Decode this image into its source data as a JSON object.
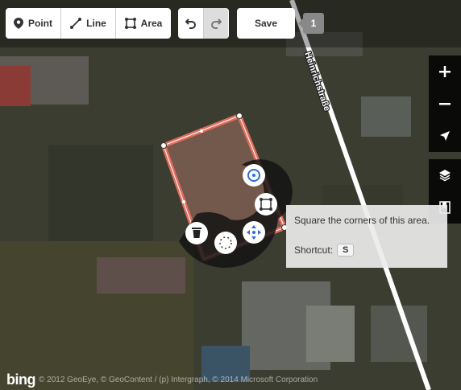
{
  "toolbar": {
    "point_label": "Point",
    "line_label": "Line",
    "area_label": "Area",
    "save_label": "Save",
    "edit_count": "1"
  },
  "map": {
    "street_name": "Heinrichstraße"
  },
  "tooltip": {
    "text": "Square the corners of this area.",
    "shortcut_label": "Shortcut:",
    "shortcut_key": "S"
  },
  "attribution": {
    "logo": "bing",
    "text": "© 2012 GeoEye, © GeoContent / (p) Intergraph, © 2014 Microsoft Corporation"
  },
  "icons": [
    "point-icon",
    "line-icon",
    "area-icon",
    "undo-icon",
    "redo-icon",
    "zoom-in-icon",
    "zoom-out-icon",
    "locate-icon",
    "layers-icon",
    "map-data-icon",
    "circularize-icon",
    "square-icon",
    "delete-icon",
    "move-icon",
    "rotate-icon"
  ],
  "colors": {
    "selection": "#e06e5f",
    "menu_background": "#1b1b1b"
  }
}
